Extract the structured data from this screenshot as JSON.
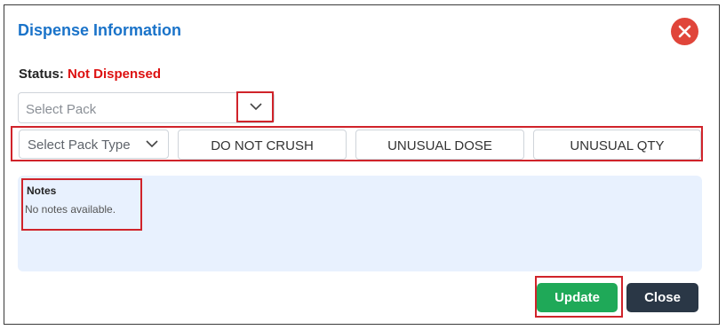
{
  "dialog": {
    "title": "Dispense Information",
    "close_icon": "close-circle-icon"
  },
  "status": {
    "label": "Status:",
    "value": "Not Dispensed",
    "value_color": "#dd1111"
  },
  "select_pack": {
    "placeholder": "Select Pack",
    "icon": "chevron-down-icon"
  },
  "pack_type": {
    "placeholder": "Select Pack Type",
    "icon": "chevron-down-icon"
  },
  "flags": [
    {
      "label": "DO NOT CRUSH"
    },
    {
      "label": "UNUSUAL DOSE"
    },
    {
      "label": "UNUSUAL QTY"
    }
  ],
  "notes": {
    "title": "Notes",
    "text": "No notes available."
  },
  "footer": {
    "update_label": "Update",
    "close_label": "Close"
  },
  "colors": {
    "title": "#1a73c9",
    "highlight": "#d0232a",
    "update": "#1fa958",
    "close": "#2a3746",
    "notes_bg": "#e8f1fe",
    "close_icon_bg": "#e0453a"
  }
}
